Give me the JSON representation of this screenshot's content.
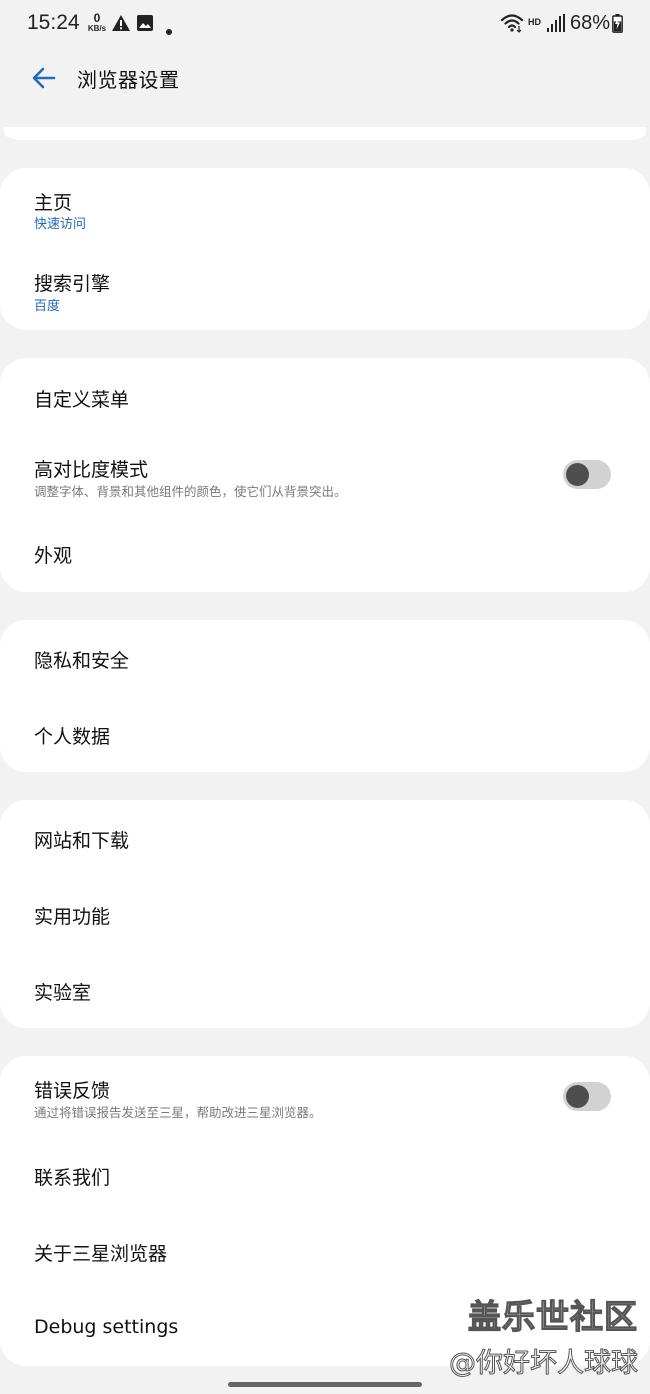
{
  "status_bar": {
    "time": "15:24",
    "net_speed_value": "0",
    "net_speed_unit": "KB/s",
    "notification_icons": [
      "warning-icon",
      "image-icon",
      "dot-icon"
    ],
    "network_badge": "HD",
    "battery_percent": "68%"
  },
  "header": {
    "title": "浏览器设置"
  },
  "sections": {
    "s1": {
      "homepage": {
        "title": "主页",
        "subtitle": "快速访问"
      },
      "search_engine": {
        "title": "搜索引擎",
        "subtitle": "百度"
      }
    },
    "s2": {
      "custom_menu": {
        "title": "自定义菜单"
      },
      "high_contrast": {
        "title": "高对比度模式",
        "subtitle": "调整字体、背景和其他组件的颜色，使它们从背景突出。",
        "enabled": false
      },
      "appearance": {
        "title": "外观"
      }
    },
    "s3": {
      "privacy": {
        "title": "隐私和安全"
      },
      "personal_data": {
        "title": "个人数据"
      }
    },
    "s4": {
      "sites_downloads": {
        "title": "网站和下载"
      },
      "useful_features": {
        "title": "实用功能"
      },
      "labs": {
        "title": "实验室"
      }
    },
    "s5": {
      "error_feedback": {
        "title": "错误反馈",
        "subtitle": "通过将错误报告发送至三星，帮助改进三星浏览器。",
        "enabled": false
      },
      "contact_us": {
        "title": "联系我们"
      },
      "about": {
        "title": "关于三星浏览器"
      },
      "debug": {
        "title": "Debug settings"
      }
    }
  },
  "watermark": {
    "line1": "盖乐世社区",
    "line2": "@你好坏人球球"
  },
  "colors": {
    "background": "#f2f2f2",
    "card": "#ffffff",
    "accent_blue": "#2369b8",
    "toggle_track": "#d2d2d2",
    "toggle_knob": "#4e4e4e"
  }
}
